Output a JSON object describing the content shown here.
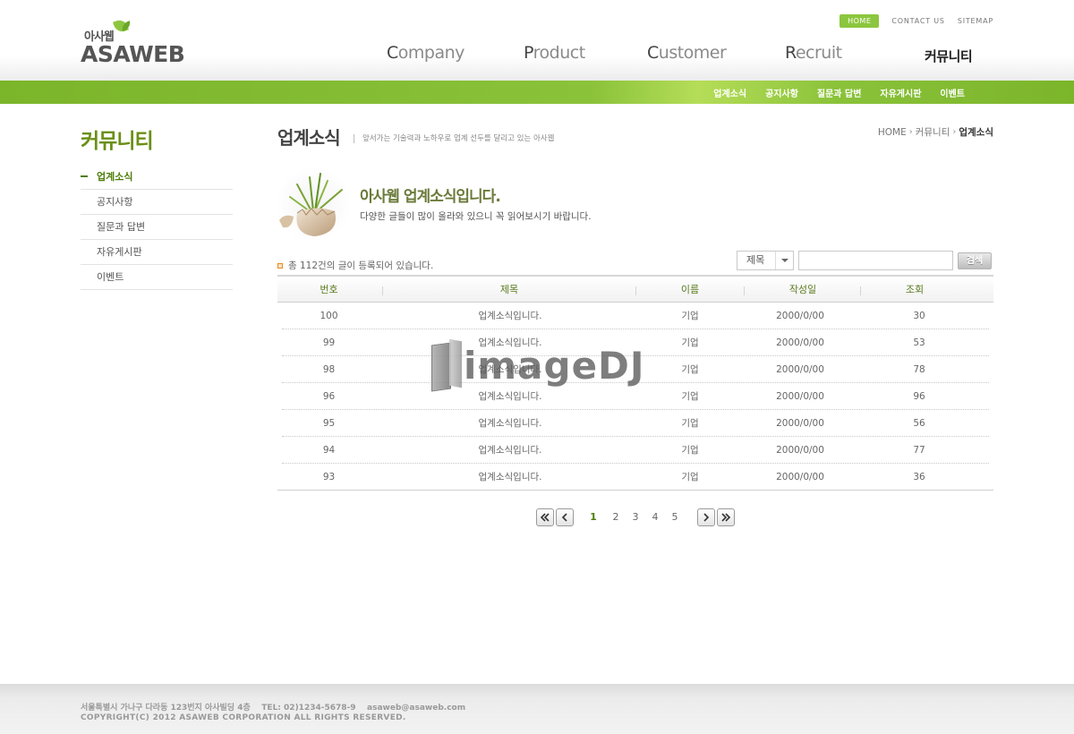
{
  "logo": {
    "sub": "아사웹",
    "main": "ASAWEB"
  },
  "util_nav": {
    "home": "HOME",
    "contact": "CONTACT US",
    "sitemap": "SITEMAP"
  },
  "gnb": {
    "company": {
      "cap": "C",
      "rest": "ompany"
    },
    "product": {
      "cap": "P",
      "rest": "roduct"
    },
    "customer": {
      "cap": "C",
      "rest": "ustomer"
    },
    "recruit": {
      "cap": "R",
      "rest": "ecruit"
    },
    "community": "커뮤니티"
  },
  "sub_nav": [
    "업계소식",
    "공지사항",
    "질문과 답변",
    "자유게시판",
    "이벤트"
  ],
  "sidebar": {
    "title": "커뮤니티",
    "items": [
      "업계소식",
      "공지사항",
      "질문과 답변",
      "자유게시판",
      "이벤트"
    ],
    "active_index": 0
  },
  "page": {
    "title": "업계소식",
    "description": "앞서가는 기술력과 노하우로 업계 선두를 달리고 있는 아사웹",
    "breadcrumb": [
      "HOME",
      "커뮤니티",
      "업계소식"
    ]
  },
  "intro": {
    "title": "아사웹 업계소식입니다.",
    "text": "다양한 글들이 많이 올라와 있으니 꼭 읽어보시기 바랍니다."
  },
  "board": {
    "total_text": "총 112건의 글이 등록되어 있습니다.",
    "search": {
      "select_value": "제목",
      "input_value": "",
      "button": "검색"
    },
    "columns": [
      "번호",
      "제목",
      "이름",
      "작성일",
      "조회"
    ],
    "rows": [
      [
        "100",
        "업계소식입니다.",
        "기업",
        "2000/0/00",
        "30"
      ],
      [
        "99",
        "업계소식입니다.",
        "기업",
        "2000/0/00",
        "53"
      ],
      [
        "98",
        "업계소식입니다.",
        "기업",
        "2000/0/00",
        "78"
      ],
      [
        "96",
        "업계소식입니다.",
        "기업",
        "2000/0/00",
        "96"
      ],
      [
        "95",
        "업계소식입니다.",
        "기업",
        "2000/0/00",
        "56"
      ],
      [
        "94",
        "업계소식입니다.",
        "기업",
        "2000/0/00",
        "77"
      ],
      [
        "93",
        "업계소식입니다.",
        "기업",
        "2000/0/00",
        "36"
      ]
    ]
  },
  "paging": {
    "pages": [
      "1",
      "2",
      "3",
      "4",
      "5"
    ],
    "current": "1"
  },
  "watermark": "imageDJ",
  "footer": {
    "address": "서울특별시 가나구 다라동 123번지 아사빌딩 4층    TEL: 02)1234-5678-9    asaweb@asaweb.com",
    "copyright": "COPYRIGHT(C) 2012 ASAWEB CORPORATION ALL RIGHTS RESERVED."
  },
  "colors": {
    "brand_green": "#8cc63e",
    "dark_green": "#4f7d0a",
    "title_green": "#6a8f16"
  }
}
